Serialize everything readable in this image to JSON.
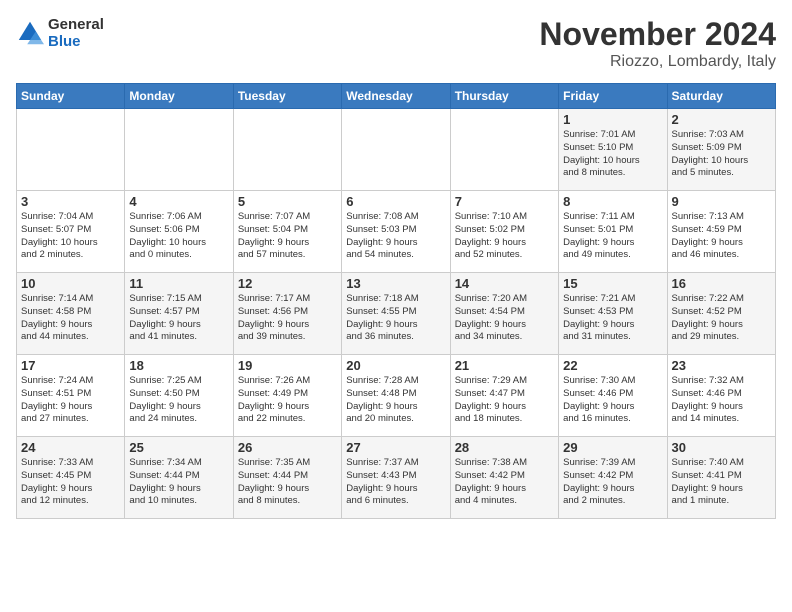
{
  "logo": {
    "line1": "General",
    "line2": "Blue"
  },
  "title": "November 2024",
  "subtitle": "Riozzo, Lombardy, Italy",
  "days_of_week": [
    "Sunday",
    "Monday",
    "Tuesday",
    "Wednesday",
    "Thursday",
    "Friday",
    "Saturday"
  ],
  "weeks": [
    [
      {
        "day": "",
        "info": ""
      },
      {
        "day": "",
        "info": ""
      },
      {
        "day": "",
        "info": ""
      },
      {
        "day": "",
        "info": ""
      },
      {
        "day": "",
        "info": ""
      },
      {
        "day": "1",
        "info": "Sunrise: 7:01 AM\nSunset: 5:10 PM\nDaylight: 10 hours\nand 8 minutes."
      },
      {
        "day": "2",
        "info": "Sunrise: 7:03 AM\nSunset: 5:09 PM\nDaylight: 10 hours\nand 5 minutes."
      }
    ],
    [
      {
        "day": "3",
        "info": "Sunrise: 7:04 AM\nSunset: 5:07 PM\nDaylight: 10 hours\nand 2 minutes."
      },
      {
        "day": "4",
        "info": "Sunrise: 7:06 AM\nSunset: 5:06 PM\nDaylight: 10 hours\nand 0 minutes."
      },
      {
        "day": "5",
        "info": "Sunrise: 7:07 AM\nSunset: 5:04 PM\nDaylight: 9 hours\nand 57 minutes."
      },
      {
        "day": "6",
        "info": "Sunrise: 7:08 AM\nSunset: 5:03 PM\nDaylight: 9 hours\nand 54 minutes."
      },
      {
        "day": "7",
        "info": "Sunrise: 7:10 AM\nSunset: 5:02 PM\nDaylight: 9 hours\nand 52 minutes."
      },
      {
        "day": "8",
        "info": "Sunrise: 7:11 AM\nSunset: 5:01 PM\nDaylight: 9 hours\nand 49 minutes."
      },
      {
        "day": "9",
        "info": "Sunrise: 7:13 AM\nSunset: 4:59 PM\nDaylight: 9 hours\nand 46 minutes."
      }
    ],
    [
      {
        "day": "10",
        "info": "Sunrise: 7:14 AM\nSunset: 4:58 PM\nDaylight: 9 hours\nand 44 minutes."
      },
      {
        "day": "11",
        "info": "Sunrise: 7:15 AM\nSunset: 4:57 PM\nDaylight: 9 hours\nand 41 minutes."
      },
      {
        "day": "12",
        "info": "Sunrise: 7:17 AM\nSunset: 4:56 PM\nDaylight: 9 hours\nand 39 minutes."
      },
      {
        "day": "13",
        "info": "Sunrise: 7:18 AM\nSunset: 4:55 PM\nDaylight: 9 hours\nand 36 minutes."
      },
      {
        "day": "14",
        "info": "Sunrise: 7:20 AM\nSunset: 4:54 PM\nDaylight: 9 hours\nand 34 minutes."
      },
      {
        "day": "15",
        "info": "Sunrise: 7:21 AM\nSunset: 4:53 PM\nDaylight: 9 hours\nand 31 minutes."
      },
      {
        "day": "16",
        "info": "Sunrise: 7:22 AM\nSunset: 4:52 PM\nDaylight: 9 hours\nand 29 minutes."
      }
    ],
    [
      {
        "day": "17",
        "info": "Sunrise: 7:24 AM\nSunset: 4:51 PM\nDaylight: 9 hours\nand 27 minutes."
      },
      {
        "day": "18",
        "info": "Sunrise: 7:25 AM\nSunset: 4:50 PM\nDaylight: 9 hours\nand 24 minutes."
      },
      {
        "day": "19",
        "info": "Sunrise: 7:26 AM\nSunset: 4:49 PM\nDaylight: 9 hours\nand 22 minutes."
      },
      {
        "day": "20",
        "info": "Sunrise: 7:28 AM\nSunset: 4:48 PM\nDaylight: 9 hours\nand 20 minutes."
      },
      {
        "day": "21",
        "info": "Sunrise: 7:29 AM\nSunset: 4:47 PM\nDaylight: 9 hours\nand 18 minutes."
      },
      {
        "day": "22",
        "info": "Sunrise: 7:30 AM\nSunset: 4:46 PM\nDaylight: 9 hours\nand 16 minutes."
      },
      {
        "day": "23",
        "info": "Sunrise: 7:32 AM\nSunset: 4:46 PM\nDaylight: 9 hours\nand 14 minutes."
      }
    ],
    [
      {
        "day": "24",
        "info": "Sunrise: 7:33 AM\nSunset: 4:45 PM\nDaylight: 9 hours\nand 12 minutes."
      },
      {
        "day": "25",
        "info": "Sunrise: 7:34 AM\nSunset: 4:44 PM\nDaylight: 9 hours\nand 10 minutes."
      },
      {
        "day": "26",
        "info": "Sunrise: 7:35 AM\nSunset: 4:44 PM\nDaylight: 9 hours\nand 8 minutes."
      },
      {
        "day": "27",
        "info": "Sunrise: 7:37 AM\nSunset: 4:43 PM\nDaylight: 9 hours\nand 6 minutes."
      },
      {
        "day": "28",
        "info": "Sunrise: 7:38 AM\nSunset: 4:42 PM\nDaylight: 9 hours\nand 4 minutes."
      },
      {
        "day": "29",
        "info": "Sunrise: 7:39 AM\nSunset: 4:42 PM\nDaylight: 9 hours\nand 2 minutes."
      },
      {
        "day": "30",
        "info": "Sunrise: 7:40 AM\nSunset: 4:41 PM\nDaylight: 9 hours\nand 1 minute."
      }
    ]
  ]
}
